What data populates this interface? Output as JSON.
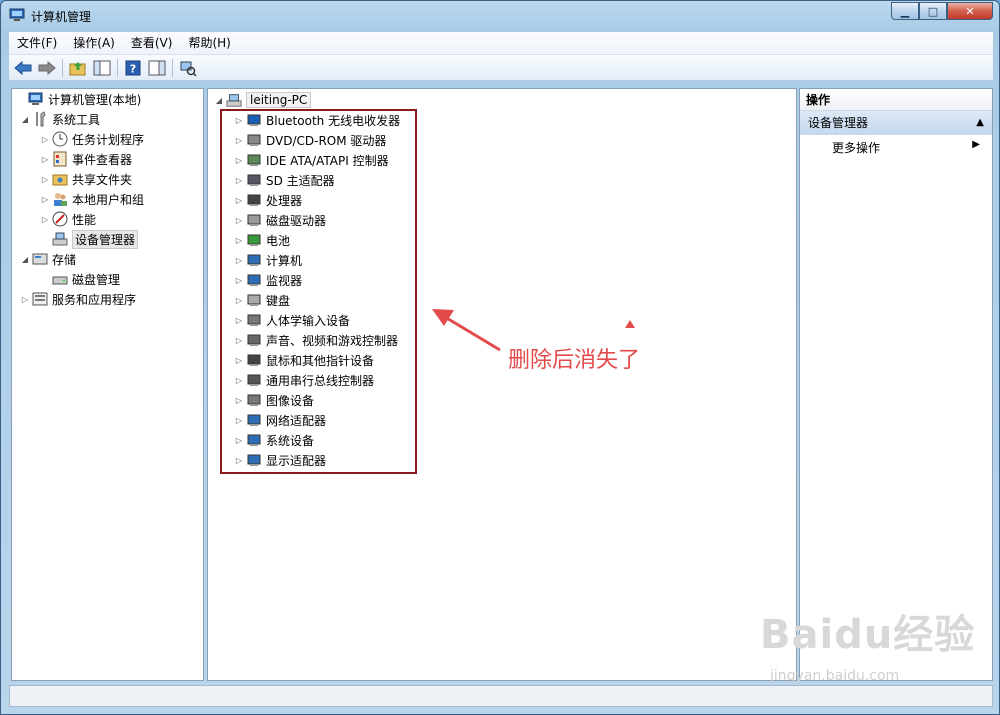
{
  "window": {
    "title": "计算机管理"
  },
  "menu": [
    "文件(F)",
    "操作(A)",
    "查看(V)",
    "帮助(H)"
  ],
  "toolbar": [
    "back-icon",
    "forward-icon",
    "up-folder-icon",
    "show-hide-tree-icon",
    "help-icon",
    "show-hide-action-icon",
    "scan-hardware-icon"
  ],
  "left_tree": {
    "root": "计算机管理(本地)",
    "system_tools": "系统工具",
    "task_scheduler": "任务计划程序",
    "event_viewer": "事件查看器",
    "shared_folders": "共享文件夹",
    "local_users": "本地用户和组",
    "performance": "性能",
    "device_manager": "设备管理器",
    "storage": "存储",
    "disk_management": "磁盘管理",
    "services_apps": "服务和应用程序"
  },
  "device_tree": {
    "computer": "leiting-PC",
    "categories": [
      "Bluetooth 无线电收发器",
      "DVD/CD-ROM 驱动器",
      "IDE ATA/ATAPI 控制器",
      "SD 主适配器",
      "处理器",
      "磁盘驱动器",
      "电池",
      "计算机",
      "监视器",
      "键盘",
      "人体学输入设备",
      "声音、视频和游戏控制器",
      "鼠标和其他指针设备",
      "通用串行总线控制器",
      "图像设备",
      "网络适配器",
      "系统设备",
      "显示适配器"
    ]
  },
  "actions": {
    "header": "操作",
    "group": "设备管理器",
    "more": "更多操作"
  },
  "annotation": {
    "text": "删除后消失了"
  },
  "watermark": {
    "text": "Baidu经验",
    "sub": "jingyan.baidu.com"
  },
  "colors": {
    "annotation_red": "#e34a4a",
    "box_border": "#8b1a1a"
  }
}
